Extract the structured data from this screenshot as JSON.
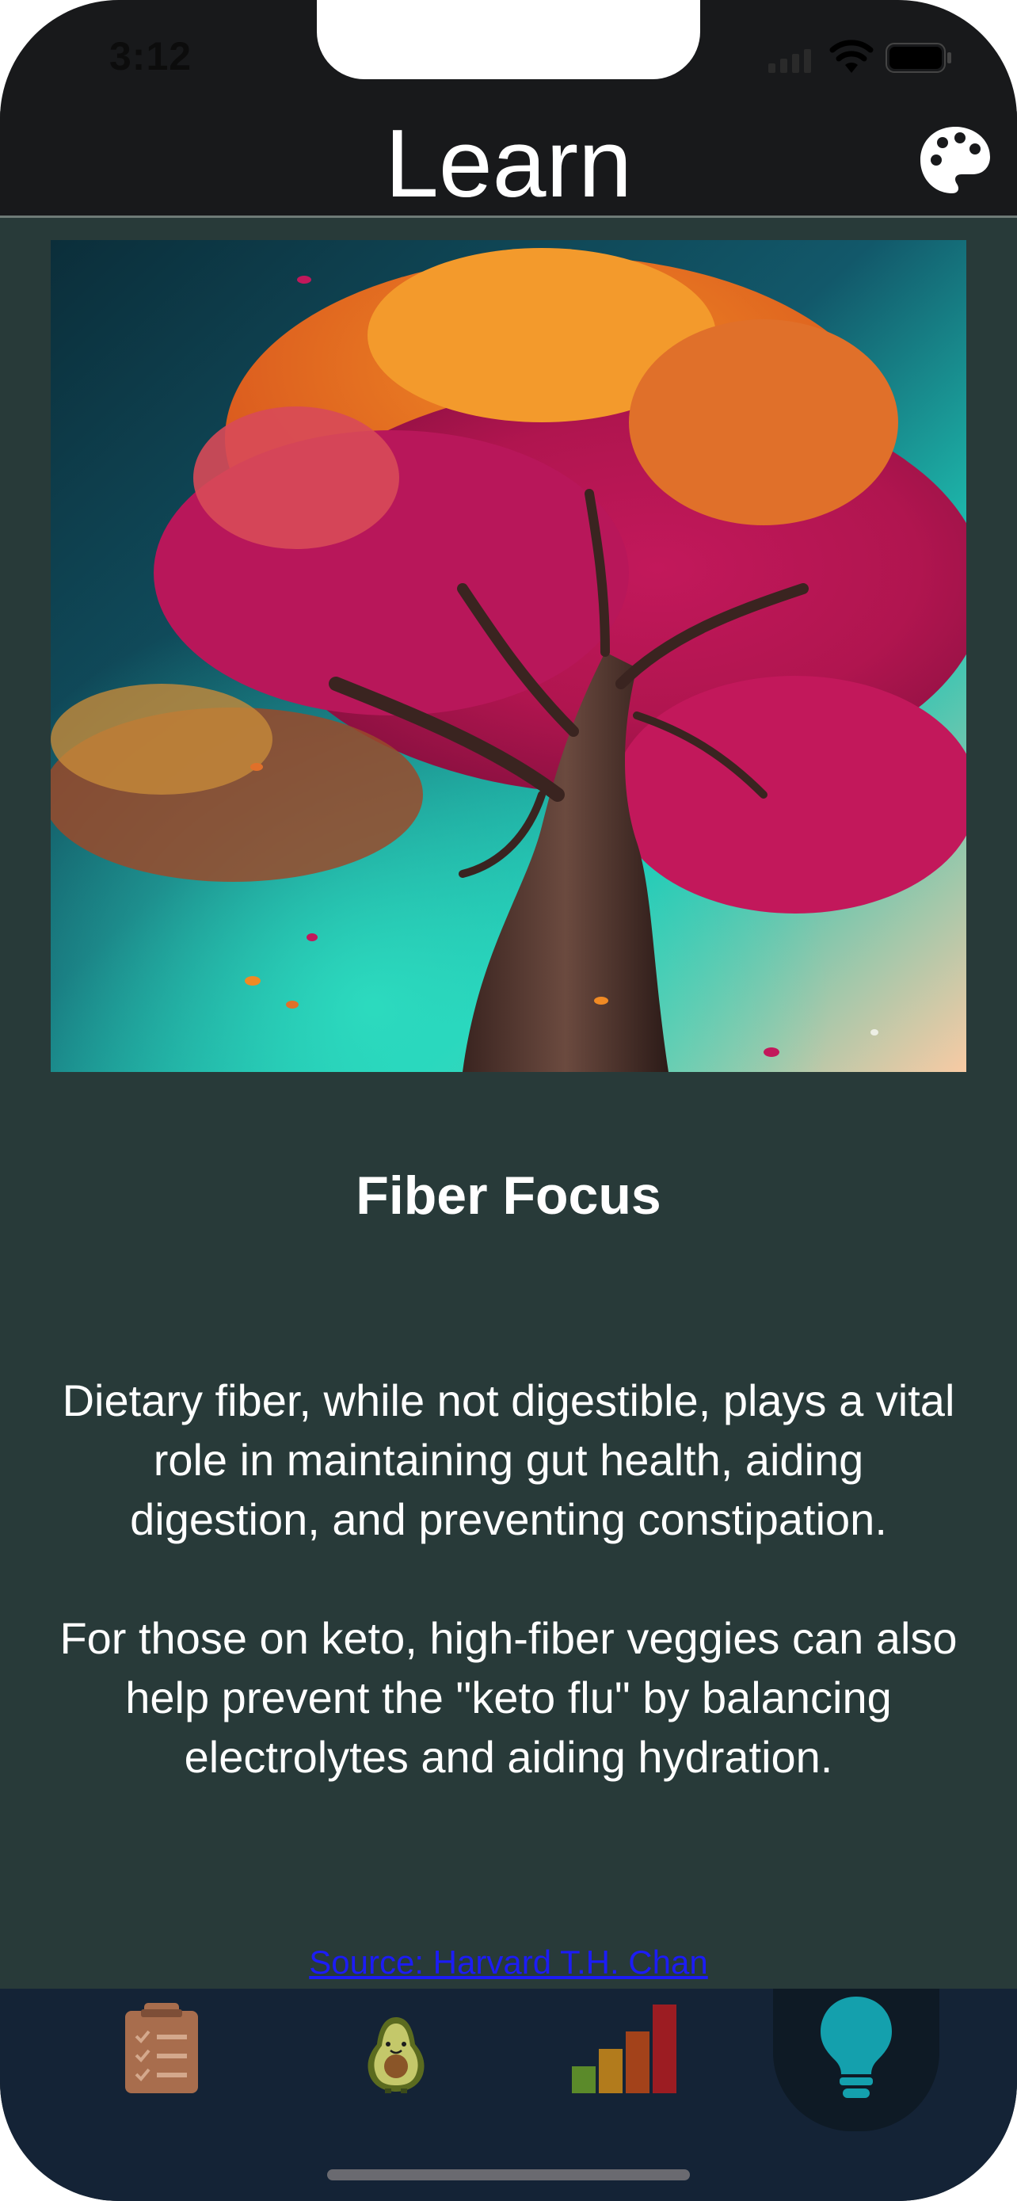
{
  "status_bar": {
    "time": "3:12",
    "icons": [
      "signal-icon",
      "wifi-icon",
      "battery-icon"
    ]
  },
  "header": {
    "title": "Learn",
    "right_icon": "palette-icon"
  },
  "article": {
    "image": "autumn-tree-illustration",
    "title": "Fiber Focus",
    "paragraphs": [
      "Dietary fiber, while not digestible, plays a vital role in maintaining gut health, aiding digestion, and preventing constipation.",
      "For those on keto, high-fiber veggies can also help prevent the \"keto flu\" by balancing electrolytes and aiding hydration."
    ],
    "source_link": "Source: Harvard T.H. Chan"
  },
  "tab_bar": {
    "tabs": [
      {
        "icon": "clipboard-checklist-icon",
        "selected": false
      },
      {
        "icon": "avocado-icon",
        "selected": false
      },
      {
        "icon": "bar-chart-icon",
        "selected": false
      },
      {
        "icon": "lightbulb-icon",
        "selected": true
      }
    ]
  },
  "colors": {
    "header_bg": "#18191b",
    "content_bg": "#283a39",
    "tab_bar_bg": "#142336",
    "selected_tab_bg": "#0e1a25",
    "accent": "#14a0ad",
    "link": "#1c1cf5"
  }
}
